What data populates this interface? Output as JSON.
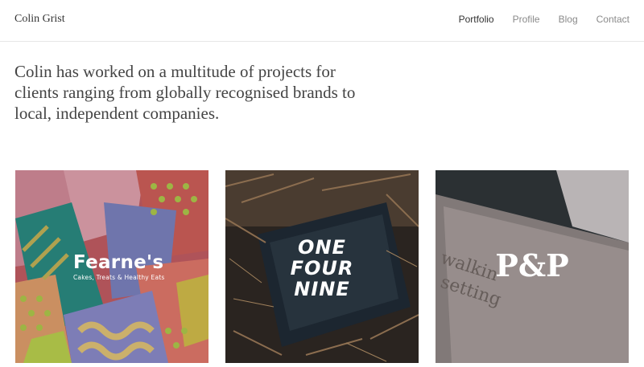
{
  "header": {
    "brand": "Colin Grist",
    "nav": [
      {
        "label": "Portfolio",
        "active": true
      },
      {
        "label": "Profile",
        "active": false
      },
      {
        "label": "Blog",
        "active": false
      },
      {
        "label": "Contact",
        "active": false
      }
    ]
  },
  "intro": {
    "text": "Colin has worked on a multitude of projects for clients ranging from globally recognised brands to local, independent companies."
  },
  "portfolio": [
    {
      "title": "Fearne's",
      "subtitle": "Cakes, Treats & Healthy Eats"
    },
    {
      "lines": [
        "ONE",
        "FOUR",
        "NINE"
      ]
    },
    {
      "title": "P&P"
    }
  ],
  "colors": {
    "nav_active": "#333333",
    "nav_inactive": "#8a8a8a",
    "divider": "#e6e6e6"
  }
}
